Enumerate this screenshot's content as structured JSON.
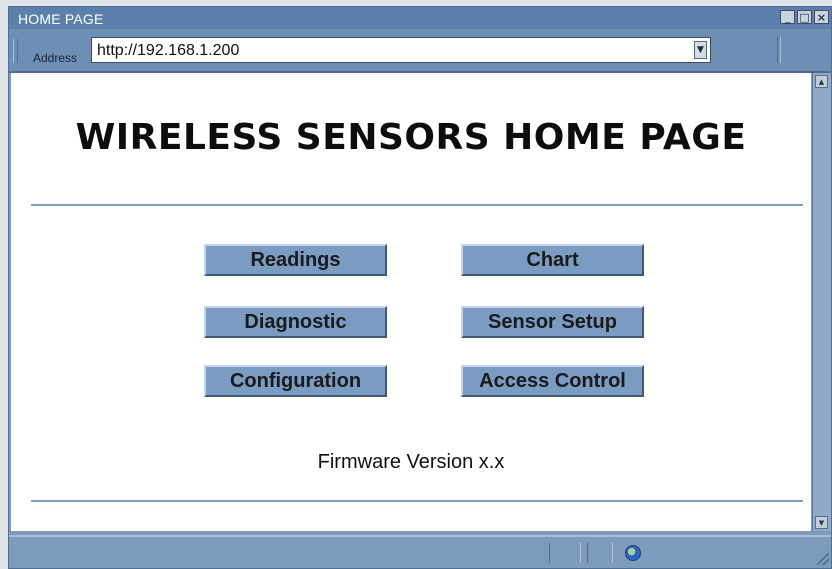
{
  "window": {
    "title": "HOME PAGE"
  },
  "address_bar": {
    "label": "Address",
    "url": "http://192.168.1.200"
  },
  "page": {
    "title": "WIRELESS SENSORS HOME PAGE",
    "buttons": {
      "readings": "Readings",
      "chart": "Chart",
      "diagnostic": "Diagnostic",
      "sensor_setup": "Sensor Setup",
      "configuration": "Configuration",
      "access_control": "Access Control"
    },
    "firmware": "Firmware Version x.x"
  },
  "icons": {
    "minimize": "minimize-icon",
    "maximize": "maximize-icon",
    "close": "close-icon",
    "dropdown": "chevron-down-icon",
    "globe": "globe-icon"
  },
  "colors": {
    "button": "#7a9cc2",
    "frame": "#7d9bbd",
    "rule": "#7f9fc0"
  }
}
